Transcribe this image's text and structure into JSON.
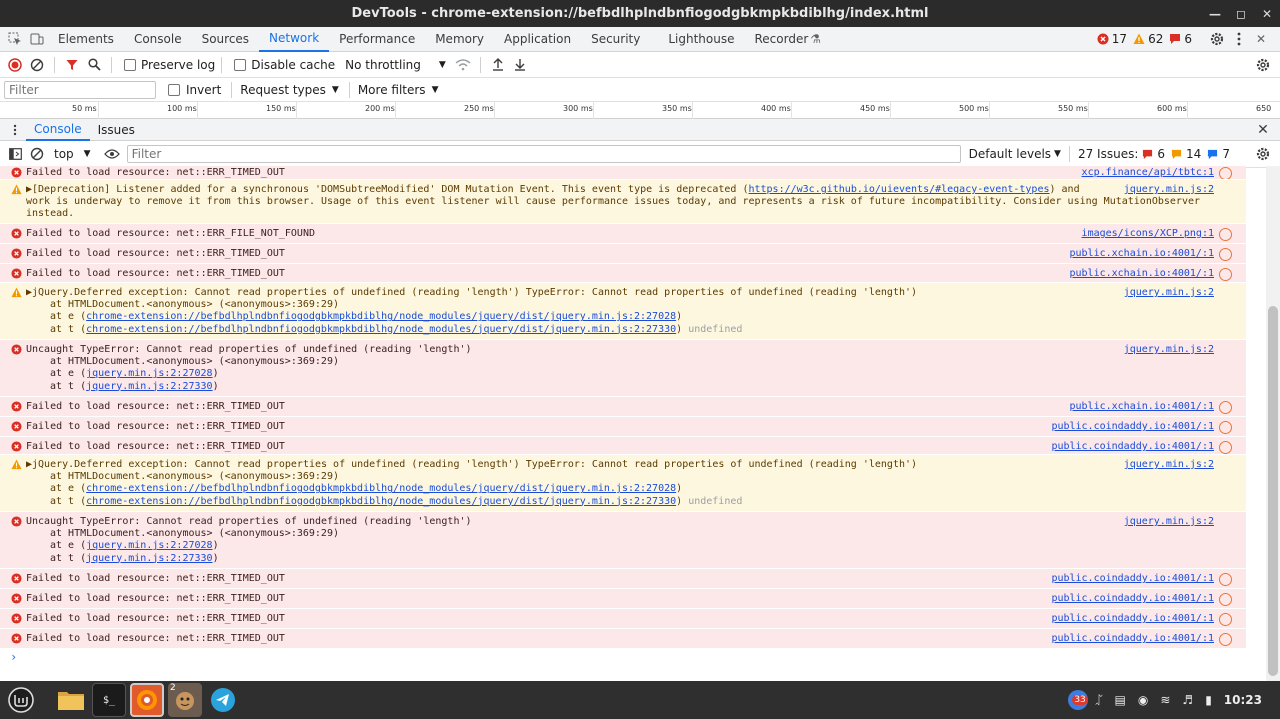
{
  "window": {
    "title": "DevTools - chrome-extension://befbdlhplndbnfiogodgbkmpkbdiblhg/index.html"
  },
  "tabs": [
    "Elements",
    "Console",
    "Sources",
    "Network",
    "Performance",
    "Memory",
    "Application",
    "Security",
    "Lighthouse",
    "Recorder"
  ],
  "active_tab": "Network",
  "counts": {
    "errors": "17",
    "warnings": "62",
    "issues": "6"
  },
  "network_toolbar": {
    "preserve_log": "Preserve log",
    "disable_cache": "Disable cache",
    "throttling": "No throttling"
  },
  "network_filter": {
    "placeholder": "Filter",
    "invert": "Invert",
    "request_types": "Request types",
    "more_filters": "More filters"
  },
  "timeline_ticks": [
    "50 ms",
    "100 ms",
    "150 ms",
    "200 ms",
    "250 ms",
    "300 ms",
    "350 ms",
    "400 ms",
    "450 ms",
    "500 ms",
    "550 ms",
    "600 ms",
    "650"
  ],
  "drawer": {
    "tabs": [
      "Console",
      "Issues"
    ]
  },
  "console_toolbar": {
    "context": "top",
    "filter_placeholder": "Filter",
    "levels": "Default levels",
    "issues_label": "27 Issues:",
    "issues_error": "6",
    "issues_warn": "14",
    "issues_info": "7"
  },
  "messages": [
    {
      "type": "error",
      "text": "Failed to load resource: net::ERR_TIMED_OUT",
      "source": "xcp.finance/api/tbtc:1"
    },
    {
      "type": "warn",
      "text": "▶[Deprecation] Listener added for a synchronous 'DOMSubtreeModified' DOM Mutation Event. This event type is deprecated (",
      "link": "https://w3c.github.io/uievents/#legacy-event-types",
      "text2": ") and",
      "cont": "work is underway to remove it from this browser. Usage of this event listener will cause performance issues today, and represents a risk of future incompatibility. Consider using MutationObserver instead.",
      "source": "jquery.min.js:2"
    },
    {
      "type": "error",
      "text": "Failed to load resource: net::ERR_FILE_NOT_FOUND",
      "source": "images/icons/XCP.png:1"
    },
    {
      "type": "error",
      "text": "Failed to load resource: net::ERR_TIMED_OUT",
      "source": "public.xchain.io:4001/:1"
    },
    {
      "type": "error",
      "text": "Failed to load resource: net::ERR_TIMED_OUT",
      "source": "public.xchain.io:4001/:1"
    },
    {
      "type": "warn",
      "text": "▶jQuery.Deferred exception: Cannot read properties of undefined (reading 'length') TypeError: Cannot read properties of undefined (reading 'length')",
      "source": "jquery.min.js:2",
      "stack": [
        {
          "pre": "at HTMLDocument.<anonymous> (<anonymous>:369:29)"
        },
        {
          "pre": "at e (",
          "link": "chrome-extension://befbdlhplndbnfiogodgbkmpkbdiblhg/node_modules/jquery/dist/jquery.min.js:2:27028",
          "post": ")"
        },
        {
          "pre": "at t (",
          "link": "chrome-extension://befbdlhplndbnfiogodgbkmpkbdiblhg/node_modules/jquery/dist/jquery.min.js:2:27330",
          "post": ")",
          "undef": "undefined"
        }
      ]
    },
    {
      "type": "error",
      "text": "Uncaught TypeError: Cannot read properties of undefined (reading 'length')",
      "source": "jquery.min.js:2",
      "stack": [
        {
          "pre": "at HTMLDocument.<anonymous> (<anonymous>:369:29)"
        },
        {
          "pre": "at e (",
          "link": "jquery.min.js:2:27028",
          "post": ")"
        },
        {
          "pre": "at t (",
          "link": "jquery.min.js:2:27330",
          "post": ")"
        }
      ]
    },
    {
      "type": "error",
      "text": "Failed to load resource: net::ERR_TIMED_OUT",
      "source": "public.xchain.io:4001/:1"
    },
    {
      "type": "error",
      "text": "Failed to load resource: net::ERR_TIMED_OUT",
      "source": "public.coindaddy.io:4001/:1"
    },
    {
      "type": "error",
      "text": "Failed to load resource: net::ERR_TIMED_OUT",
      "source": "public.coindaddy.io:4001/:1"
    },
    {
      "type": "warn",
      "text": "▶jQuery.Deferred exception: Cannot read properties of undefined (reading 'length') TypeError: Cannot read properties of undefined (reading 'length')",
      "source": "jquery.min.js:2",
      "stack": [
        {
          "pre": "at HTMLDocument.<anonymous> (<anonymous>:369:29)"
        },
        {
          "pre": "at e (",
          "link": "chrome-extension://befbdlhplndbnfiogodgbkmpkbdiblhg/node_modules/jquery/dist/jquery.min.js:2:27028",
          "post": ")"
        },
        {
          "pre": "at t (",
          "link": "chrome-extension://befbdlhplndbnfiogodgbkmpkbdiblhg/node_modules/jquery/dist/jquery.min.js:2:27330",
          "post": ")",
          "undef": "undefined"
        }
      ]
    },
    {
      "type": "error",
      "text": "Uncaught TypeError: Cannot read properties of undefined (reading 'length')",
      "source": "jquery.min.js:2",
      "stack": [
        {
          "pre": "at HTMLDocument.<anonymous> (<anonymous>:369:29)"
        },
        {
          "pre": "at e (",
          "link": "jquery.min.js:2:27028",
          "post": ")"
        },
        {
          "pre": "at t (",
          "link": "jquery.min.js:2:27330",
          "post": ")"
        }
      ]
    },
    {
      "type": "error",
      "text": "Failed to load resource: net::ERR_TIMED_OUT",
      "source": "public.coindaddy.io:4001/:1"
    },
    {
      "type": "error",
      "text": "Failed to load resource: net::ERR_TIMED_OUT",
      "source": "public.coindaddy.io:4001/:1"
    },
    {
      "type": "error",
      "text": "Failed to load resource: net::ERR_TIMED_OUT",
      "source": "public.coindaddy.io:4001/:1"
    },
    {
      "type": "error",
      "text": "Failed to load resource: net::ERR_TIMED_OUT",
      "source": "public.coindaddy.io:4001/:1"
    }
  ],
  "taskbar": {
    "notif_count": "33",
    "clock": "10:23",
    "terminal_label": "$_",
    "firefox_badge": "2"
  },
  "colors": {
    "accent": "#1a73e8",
    "error": "#d93025",
    "warning": "#f29900",
    "error_bg": "#fce8e8",
    "warning_bg": "#fef7e0"
  }
}
